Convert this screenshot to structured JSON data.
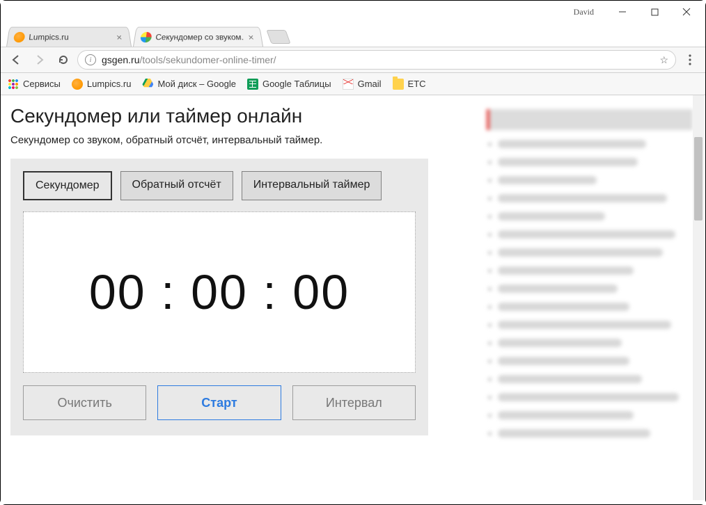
{
  "window": {
    "user": "David"
  },
  "tabs": [
    {
      "title": "Lumpics.ru"
    },
    {
      "title": "Секундомер со звуком."
    }
  ],
  "address": {
    "host": "gsgen.ru",
    "path": "/tools/sekundomer-online-timer/"
  },
  "bookmarks": {
    "apps": "Сервисы",
    "items": [
      {
        "label": "Lumpics.ru"
      },
      {
        "label": "Мой диск – Google"
      },
      {
        "label": "Google Таблицы"
      },
      {
        "label": "Gmail"
      },
      {
        "label": "ETC"
      }
    ]
  },
  "page": {
    "title": "Секундомер или таймер онлайн",
    "subtitle": "Секундомер со звуком, обратный отсчёт, интервальный таймер.",
    "modes": [
      {
        "label": "Секундомер"
      },
      {
        "label": "Обратный отсчёт"
      },
      {
        "label": "Интервальный таймер"
      }
    ],
    "time": "00 : 00 : 00",
    "controls": {
      "clear": "Очистить",
      "start": "Старт",
      "interval": "Интервал"
    }
  }
}
